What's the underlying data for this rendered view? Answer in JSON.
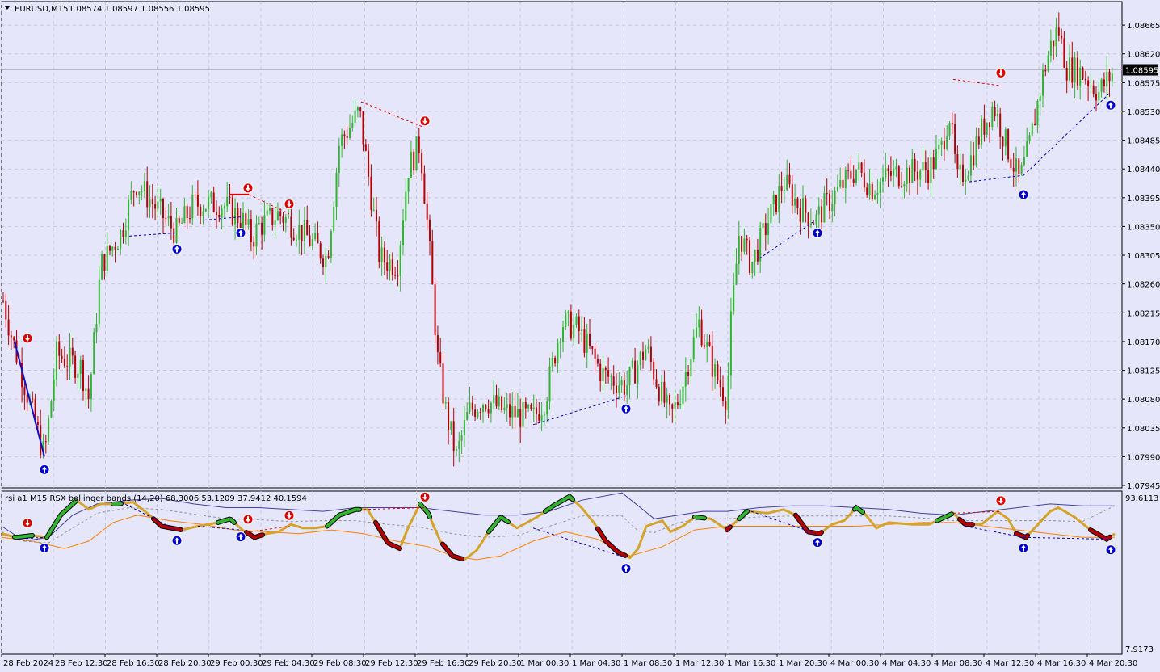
{
  "header": {
    "symbol": "EURUSD,M15",
    "ohlc": "1.08574 1.08597 1.08556 1.08595"
  },
  "indicator": {
    "title": "rsi a1 M15 RSX bollinger bands (14,20) 68.3006 53.1209 37.9412 40.1594",
    "scale_top": "93.6113",
    "scale_bottom": "7.9173"
  },
  "colors": {
    "background": "#e6e6fa",
    "grid": "#c8c8dc",
    "bull": "#32b432",
    "bear": "#b40000",
    "bull_arrow": "#0000cd",
    "bear_arrow": "#dc0000",
    "rsx": "#d4a32c",
    "band_upper": "#4040a0",
    "band_lower": "#ff8000",
    "band_mid": "#909090"
  },
  "chart_data": [
    {
      "type": "candlestick",
      "title": "EURUSD,M15",
      "ylim": [
        1.07945,
        1.08698
      ],
      "current_price": 1.08595,
      "y_ticks": [
        "1.08665",
        "1.08620",
        "1.08575",
        "1.08530",
        "1.08485",
        "1.08440",
        "1.08395",
        "1.08350",
        "1.08305",
        "1.08260",
        "1.08215",
        "1.08170",
        "1.08125",
        "1.08080",
        "1.08035",
        "1.07990",
        "1.07945"
      ],
      "x_ticks": [
        "28 Feb 2024",
        "28 Feb 12:30",
        "28 Feb 16:30",
        "28 Feb 20:30",
        "29 Feb 00:30",
        "29 Feb 04:30",
        "29 Feb 08:30",
        "29 Feb 12:30",
        "29 Feb 16:30",
        "29 Feb 20:30",
        "1 Mar 00:30",
        "1 Mar 04:30",
        "1 Mar 08:30",
        "1 Mar 12:30",
        "1 Mar 16:30",
        "1 Mar 20:30",
        "4 Mar 00:30",
        "4 Mar 04:30",
        "4 Mar 08:30",
        "4 Mar 12:30",
        "4 Mar 16:30",
        "4 Mar 20:30"
      ],
      "close_path": [
        [
          0,
          1.08255
        ],
        [
          15,
          1.08175
        ],
        [
          55,
          1.0799
        ],
        [
          70,
          1.0815
        ],
        [
          100,
          1.0813
        ],
        [
          110,
          1.0808
        ],
        [
          125,
          1.0829
        ],
        [
          150,
          1.0834
        ],
        [
          168,
          1.0842
        ],
        [
          190,
          1.08385
        ],
        [
          218,
          1.0834
        ],
        [
          240,
          1.08385
        ],
        [
          275,
          1.08385
        ],
        [
          300,
          1.0836
        ],
        [
          312,
          1.0833
        ],
        [
          320,
          1.0835
        ],
        [
          345,
          1.0837
        ],
        [
          375,
          1.0834
        ],
        [
          405,
          1.083
        ],
        [
          420,
          1.0848
        ],
        [
          445,
          1.0853
        ],
        [
          470,
          1.083
        ],
        [
          492,
          1.0829
        ],
        [
          505,
          1.0844
        ],
        [
          520,
          1.0848
        ],
        [
          530,
          1.0834
        ],
        [
          542,
          1.0814
        ],
        [
          552,
          1.0806
        ],
        [
          565,
          1.0799
        ],
        [
          580,
          1.0806
        ],
        [
          600,
          1.0808
        ],
        [
          625,
          1.0806
        ],
        [
          660,
          1.0805
        ],
        [
          675,
          1.0808
        ],
        [
          695,
          1.082
        ],
        [
          715,
          1.0819
        ],
        [
          745,
          1.0812
        ],
        [
          775,
          1.081
        ],
        [
          800,
          1.0816
        ],
        [
          815,
          1.081
        ],
        [
          830,
          1.0805
        ],
        [
          840,
          1.0808
        ],
        [
          865,
          1.082
        ],
        [
          885,
          1.0812
        ],
        [
          900,
          1.0808
        ],
        [
          905,
          1.082
        ],
        [
          915,
          1.0834
        ],
        [
          930,
          1.0829
        ],
        [
          970,
          1.0842
        ],
        [
          990,
          1.0838
        ],
        [
          1010,
          1.0836
        ],
        [
          1020,
          1.0838
        ],
        [
          1060,
          1.0844
        ],
        [
          1080,
          1.0841
        ],
        [
          1100,
          1.0843
        ],
        [
          1150,
          1.0844
        ],
        [
          1165,
          1.0847
        ],
        [
          1175,
          1.0853
        ],
        [
          1185,
          1.0842
        ],
        [
          1200,
          1.0845
        ],
        [
          1215,
          1.085
        ],
        [
          1230,
          1.0854
        ],
        [
          1245,
          1.0848
        ],
        [
          1262,
          1.0842
        ],
        [
          1275,
          1.0848
        ],
        [
          1290,
          1.0858
        ],
        [
          1300,
          1.0863
        ],
        [
          1310,
          1.0866
        ],
        [
          1320,
          1.086
        ],
        [
          1340,
          1.0859
        ],
        [
          1360,
          1.0856
        ],
        [
          1380,
          1.08595
        ]
      ],
      "bear_arrows": [
        1.0816,
        1.08395,
        1.0837,
        1.085,
        1.08575
      ],
      "bull_arrows": [
        1.0799,
        1.08335,
        1.0836,
        1.08085,
        1.0836,
        1.0842,
        1.0856
      ]
    },
    {
      "type": "line",
      "title": "rsi a1 M15 RSX bollinger bands (14,20)",
      "ylim": [
        7.9173,
        93.6113
      ],
      "last_values": {
        "upper": 68.3006,
        "middle": 53.1209,
        "lower": 37.9412,
        "rsx": 40.1594
      }
    }
  ]
}
